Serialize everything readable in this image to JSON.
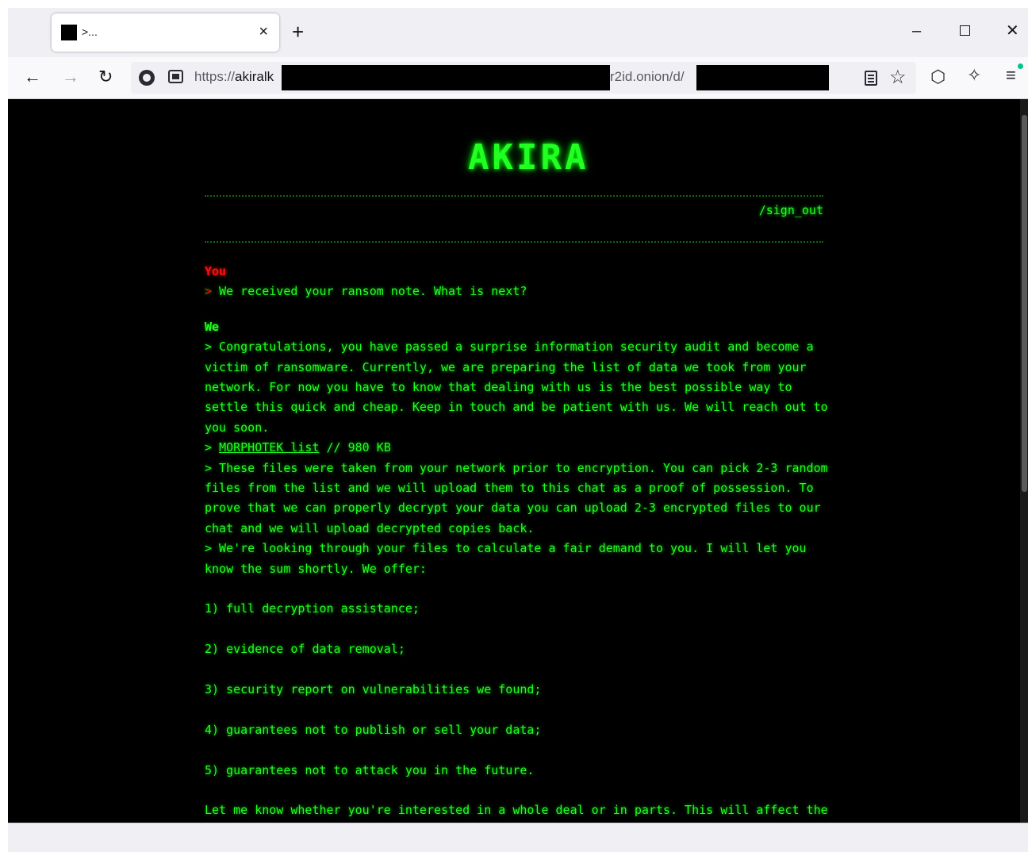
{
  "browser": {
    "tab_title": ">...",
    "tab_close": "×",
    "new_tab": "+",
    "window_minimize": "–",
    "window_close": "✕",
    "back": "←",
    "forward": "→",
    "reload": "↻",
    "url_prefix": "https://",
    "url_host_start": "akiralk",
    "url_mid": "r2id.onion/d/",
    "bookmark_star": "☆",
    "shield": "⬡",
    "clean": "✧",
    "menu": "≡",
    "update_dot_color": "#00c58a"
  },
  "site": {
    "logo": "AKIRA",
    "sign_out": "/sign_out",
    "accent_color": "#22ff22",
    "alert_color": "#ff1010"
  },
  "chat": {
    "you_label": "You",
    "you_prompt": ">",
    "you_message": "We received your ransom note. What is next?",
    "we_label": "We",
    "we_message_1": "> Congratulations, you have passed a surprise information security audit and become a victim of ransomware. Currently, we are preparing the list of data we took from your network. For now you have to know that dealing with us is the best possible way to settle this quick and cheap. Keep in touch and be patient with us. We will reach out to you soon.",
    "list_prefix": "> ",
    "list_link": "MORPHOTEK list",
    "list_size": " // 980 KB",
    "we_message_2": "> These files were taken from your network prior to encryption. You can pick 2-3 random files from the list and we will upload them to this chat as a proof of possession. To prove that we can properly decrypt your data you can upload 2-3 encrypted files to our chat and we will upload decrypted copies back.",
    "we_message_3": "> We're looking through your files to calculate a fair demand to you. I will let you know the sum shortly. We offer:",
    "offers": [
      "1) full decryption assistance;",
      "2) evidence of data removal;",
      "3) security report on vulnerabilities we found;",
      "4) guarantees not to publish or sell your data;",
      "5) guarantees not to attack you in the future."
    ],
    "closing": "Let me know whether you're interested in a whole deal or in parts. This will affect the final price."
  }
}
